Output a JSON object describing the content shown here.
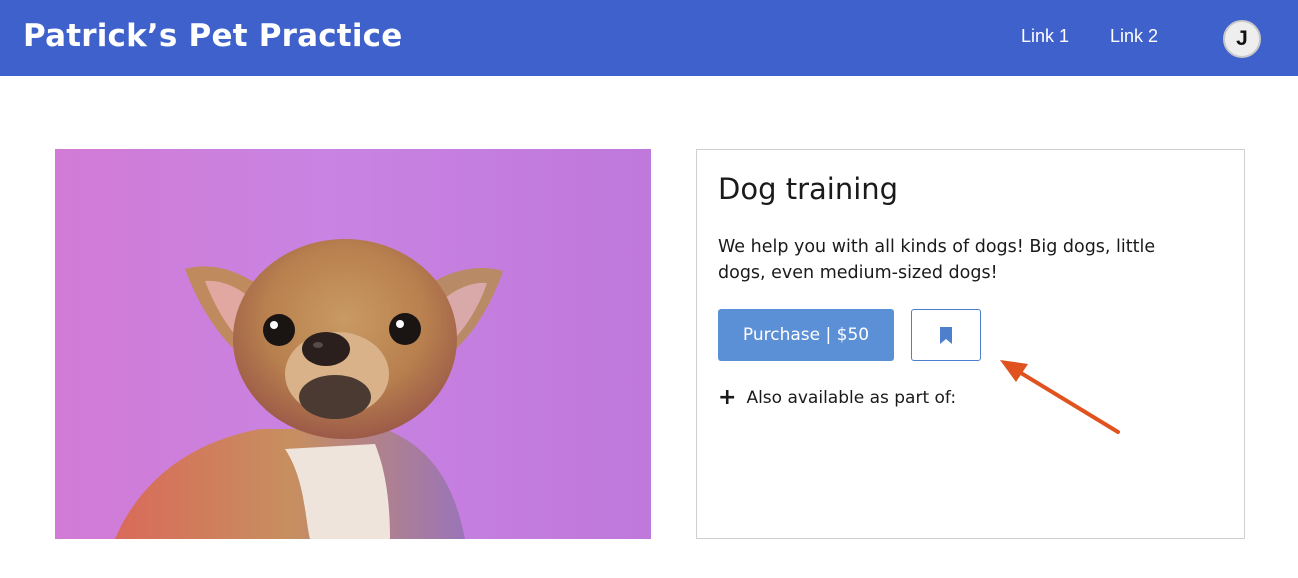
{
  "header": {
    "brand": "Patrick’s Pet Practice",
    "links": [
      "Link 1",
      "Link 2"
    ],
    "avatar_initial": "J"
  },
  "product": {
    "title": "Dog training",
    "description": "We help you with all kinds of dogs! Big dogs, little dogs, even medium-sized dogs!",
    "purchase_label": "Purchase | $50",
    "bookmark_icon": "bookmark-icon",
    "also_label": "Also available as part of:"
  },
  "colors": {
    "header_bg": "#3f61cc",
    "primary_button": "#5b8fd6",
    "annotation_arrow": "#e0521e"
  }
}
